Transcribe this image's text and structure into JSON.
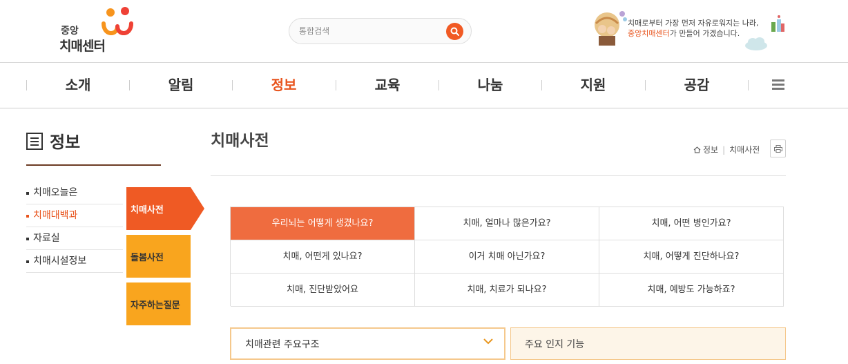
{
  "header": {
    "logo_small": "중앙",
    "logo_big": "치매센터",
    "search_placeholder": "통합검색",
    "slogan_line1": "치매로부터 가장 먼저 자유로워지는 나라,",
    "slogan_highlight": "중앙치매센터",
    "slogan_line2_rest": "가 만들어 가겠습니다."
  },
  "gnb": {
    "items": [
      {
        "label": "소개",
        "active": false
      },
      {
        "label": "알림",
        "active": false
      },
      {
        "label": "정보",
        "active": true
      },
      {
        "label": "교육",
        "active": false
      },
      {
        "label": "나눔",
        "active": false
      },
      {
        "label": "지원",
        "active": false
      },
      {
        "label": "공감",
        "active": false
      }
    ]
  },
  "lnb": {
    "title": "정보",
    "items": [
      {
        "label": "치매오늘은",
        "active": false
      },
      {
        "label": "치매대백과",
        "active": true
      },
      {
        "label": "자료실",
        "active": false
      },
      {
        "label": "치매시설정보",
        "active": false
      }
    ],
    "sub_tabs": [
      {
        "label": "치매사전",
        "active": true
      },
      {
        "label": "돌봄사전",
        "active": false
      },
      {
        "label": "자주하는질문",
        "active": false
      }
    ]
  },
  "content": {
    "page_title": "치매사전",
    "breadcrumb": [
      "정보",
      "치매사전"
    ],
    "questions": [
      "우리뇌는 어떻게 생겼나요?",
      "치매, 얼마나 많은가요?",
      "치매, 어떤 병인가요?",
      "치매, 어떤게 있나요?",
      "이거 치매 아닌가요?",
      "치매, 어떻게 진단하나요?",
      "치매, 진단받았어요",
      "치매, 치료가 되나요?",
      "치매, 예방도 가능하죠?"
    ],
    "select_label": "치매관련 주요구조",
    "info_label": "주요 인지 기능"
  },
  "colors": {
    "accent": "#ef5a24",
    "active_cell": "#ef6c3f",
    "tab_yellow": "#f9a51e",
    "rule_brown": "#6b3a22"
  }
}
